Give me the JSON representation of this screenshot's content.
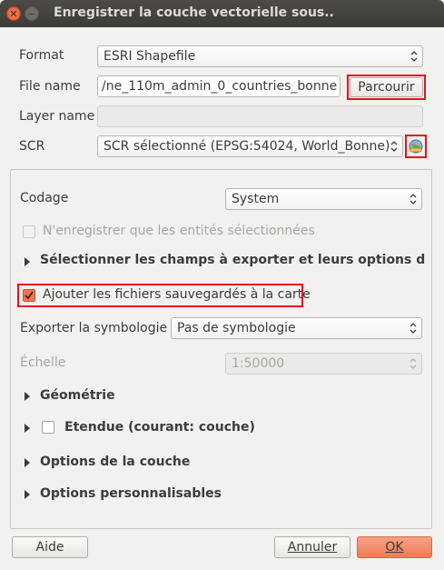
{
  "window": {
    "title": "Enregistrer la couche vectorielle sous.."
  },
  "form": {
    "format_label": "Format",
    "format_value": "ESRI Shapefile",
    "filename_label": "File name",
    "filename_value": "/ne_110m_admin_0_countries_bonne",
    "browse_label": "Parcourir",
    "layername_label": "Layer name",
    "layername_value": "",
    "crs_label": "SCR",
    "crs_value": "SCR sélectionné (EPSG:54024, World_Bonne)"
  },
  "options": {
    "encoding_label": "Codage",
    "encoding_value": "System",
    "selected_only_label": "N'enregistrer que les entités sélectionnées",
    "selected_only_checked": false,
    "fields_section_label": "Sélectionner les champs à exporter et leurs options d'expor",
    "add_to_map_label": "Ajouter les fichiers sauvegardés à la carte",
    "add_to_map_checked": true,
    "symbology_label": "Exporter la symbologie",
    "symbology_value": "Pas de symbologie",
    "scale_label": "Échelle",
    "scale_value": "1:50000",
    "geometry_section_label": "Géométrie",
    "extent_section_label": "Etendue (courant: couche)",
    "extent_checked": false,
    "layer_options_section_label": "Options de la couche",
    "custom_options_section_label": "Options personnalisables"
  },
  "footer": {
    "help_label": "Aide",
    "cancel_label": "Annuler",
    "ok_label": "OK"
  },
  "colors": {
    "highlight": "#e0141e",
    "accent": "#f07b55"
  }
}
